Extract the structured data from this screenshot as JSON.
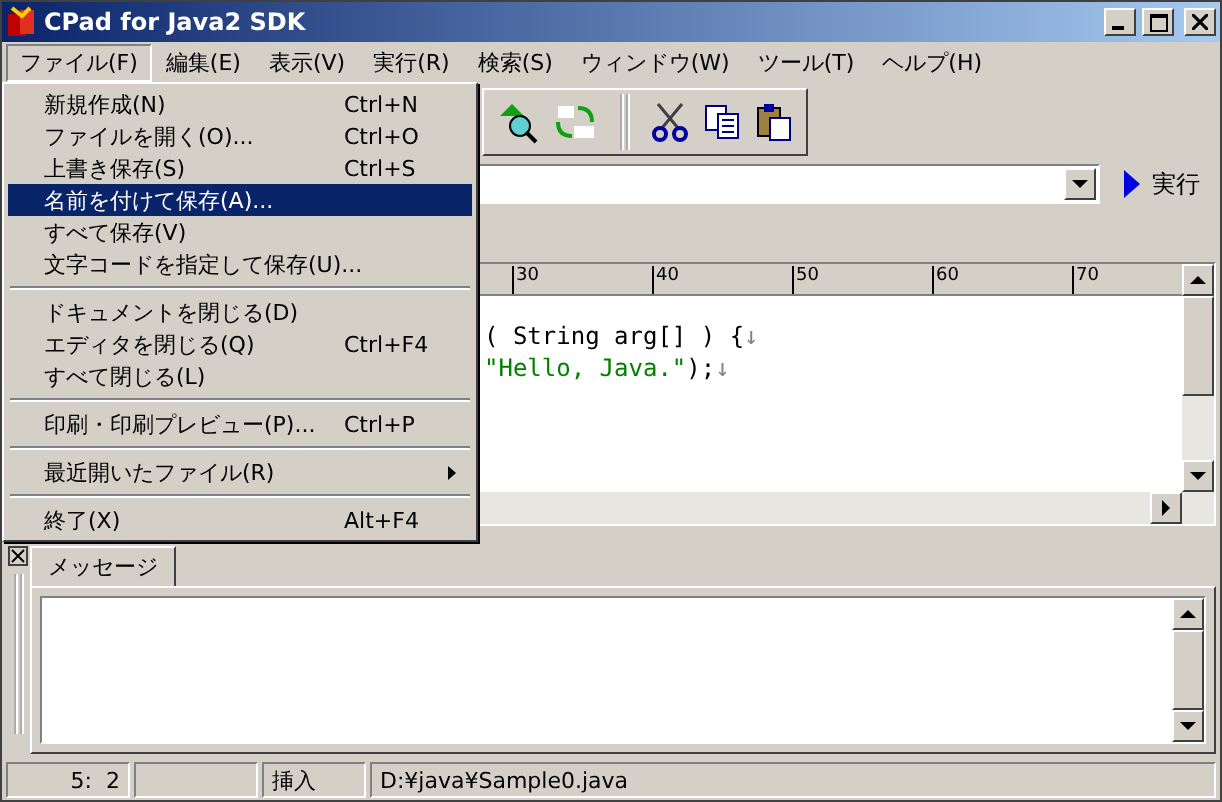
{
  "window": {
    "title": "CPad for Java2 SDK"
  },
  "menubar": [
    {
      "label": "ファイル(F)",
      "selected": true
    },
    {
      "label": "編集(E)",
      "selected": false
    },
    {
      "label": "表示(V)",
      "selected": false
    },
    {
      "label": "実行(R)",
      "selected": false
    },
    {
      "label": "検索(S)",
      "selected": false
    },
    {
      "label": "ウィンドウ(W)",
      "selected": false
    },
    {
      "label": "ツール(T)",
      "selected": false
    },
    {
      "label": "ヘルプ(H)",
      "selected": false
    }
  ],
  "file_menu": [
    {
      "kind": "item",
      "label": "新規作成(N)",
      "shortcut": "Ctrl+N",
      "selected": false
    },
    {
      "kind": "item",
      "label": "ファイルを開く(O)...",
      "shortcut": "Ctrl+O",
      "selected": false
    },
    {
      "kind": "item",
      "label": "上書き保存(S)",
      "shortcut": "Ctrl+S",
      "selected": false
    },
    {
      "kind": "item",
      "label": "名前を付けて保存(A)...",
      "selected": true
    },
    {
      "kind": "item",
      "label": "すべて保存(V)",
      "selected": false
    },
    {
      "kind": "item",
      "label": "文字コードを指定して保存(U)...",
      "selected": false
    },
    {
      "kind": "separator"
    },
    {
      "kind": "item",
      "label": "ドキュメントを閉じる(D)",
      "selected": false
    },
    {
      "kind": "item",
      "label": "エディタを閉じる(Q)",
      "shortcut": "Ctrl+F4",
      "selected": false
    },
    {
      "kind": "item",
      "label": "すべて閉じる(L)",
      "selected": false
    },
    {
      "kind": "separator"
    },
    {
      "kind": "item",
      "label": "印刷・印刷プレビュー(P)...",
      "shortcut": "Ctrl+P",
      "selected": false
    },
    {
      "kind": "separator"
    },
    {
      "kind": "submenu",
      "label": "最近開いたファイル(R)",
      "selected": false
    },
    {
      "kind": "separator"
    },
    {
      "kind": "item",
      "label": "終了(X)",
      "shortcut": "Alt+F4",
      "selected": false
    }
  ],
  "run_button": {
    "label": "実行"
  },
  "ruler": [
    "30",
    "40",
    "50",
    "60",
    "70"
  ],
  "code_lines": [
    [
      {
        "kind": "plain",
        "text": "( String arg[] ) {"
      },
      {
        "kind": "eol",
        "text": "↓"
      }
    ],
    [
      {
        "kind": "string",
        "text": "\"Hello, Java.\""
      },
      {
        "kind": "plain",
        "text": ");"
      },
      {
        "kind": "eol",
        "text": "↓"
      }
    ]
  ],
  "message_tab": {
    "label": "メッセージ",
    "selected": true
  },
  "status_bar": [
    {
      "kind": "position",
      "text": "5:  2"
    },
    {
      "kind": "empty"
    },
    {
      "kind": "mode",
      "text": "挿入"
    },
    {
      "kind": "path",
      "text": "D:¥java¥Sample0.java"
    }
  ]
}
